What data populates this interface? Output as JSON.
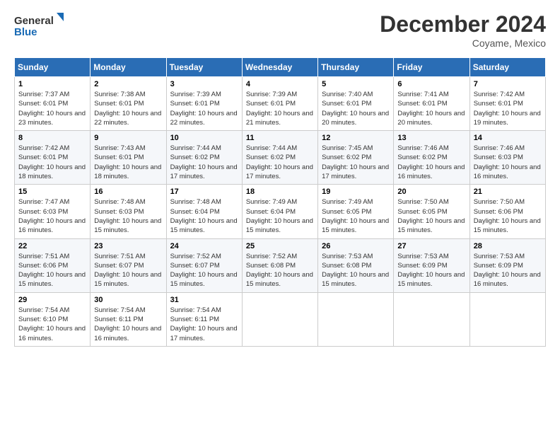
{
  "logo": {
    "line1": "General",
    "line2": "Blue"
  },
  "title": "December 2024",
  "location": "Coyame, Mexico",
  "weekdays": [
    "Sunday",
    "Monday",
    "Tuesday",
    "Wednesday",
    "Thursday",
    "Friday",
    "Saturday"
  ],
  "weeks": [
    [
      {
        "day": "1",
        "sunrise": "7:37 AM",
        "sunset": "6:01 PM",
        "daylight": "10 hours and 23 minutes."
      },
      {
        "day": "2",
        "sunrise": "7:38 AM",
        "sunset": "6:01 PM",
        "daylight": "10 hours and 22 minutes."
      },
      {
        "day": "3",
        "sunrise": "7:39 AM",
        "sunset": "6:01 PM",
        "daylight": "10 hours and 22 minutes."
      },
      {
        "day": "4",
        "sunrise": "7:39 AM",
        "sunset": "6:01 PM",
        "daylight": "10 hours and 21 minutes."
      },
      {
        "day": "5",
        "sunrise": "7:40 AM",
        "sunset": "6:01 PM",
        "daylight": "10 hours and 20 minutes."
      },
      {
        "day": "6",
        "sunrise": "7:41 AM",
        "sunset": "6:01 PM",
        "daylight": "10 hours and 20 minutes."
      },
      {
        "day": "7",
        "sunrise": "7:42 AM",
        "sunset": "6:01 PM",
        "daylight": "10 hours and 19 minutes."
      }
    ],
    [
      {
        "day": "8",
        "sunrise": "7:42 AM",
        "sunset": "6:01 PM",
        "daylight": "10 hours and 18 minutes."
      },
      {
        "day": "9",
        "sunrise": "7:43 AM",
        "sunset": "6:01 PM",
        "daylight": "10 hours and 18 minutes."
      },
      {
        "day": "10",
        "sunrise": "7:44 AM",
        "sunset": "6:02 PM",
        "daylight": "10 hours and 17 minutes."
      },
      {
        "day": "11",
        "sunrise": "7:44 AM",
        "sunset": "6:02 PM",
        "daylight": "10 hours and 17 minutes."
      },
      {
        "day": "12",
        "sunrise": "7:45 AM",
        "sunset": "6:02 PM",
        "daylight": "10 hours and 17 minutes."
      },
      {
        "day": "13",
        "sunrise": "7:46 AM",
        "sunset": "6:02 PM",
        "daylight": "10 hours and 16 minutes."
      },
      {
        "day": "14",
        "sunrise": "7:46 AM",
        "sunset": "6:03 PM",
        "daylight": "10 hours and 16 minutes."
      }
    ],
    [
      {
        "day": "15",
        "sunrise": "7:47 AM",
        "sunset": "6:03 PM",
        "daylight": "10 hours and 16 minutes."
      },
      {
        "day": "16",
        "sunrise": "7:48 AM",
        "sunset": "6:03 PM",
        "daylight": "10 hours and 15 minutes."
      },
      {
        "day": "17",
        "sunrise": "7:48 AM",
        "sunset": "6:04 PM",
        "daylight": "10 hours and 15 minutes."
      },
      {
        "day": "18",
        "sunrise": "7:49 AM",
        "sunset": "6:04 PM",
        "daylight": "10 hours and 15 minutes."
      },
      {
        "day": "19",
        "sunrise": "7:49 AM",
        "sunset": "6:05 PM",
        "daylight": "10 hours and 15 minutes."
      },
      {
        "day": "20",
        "sunrise": "7:50 AM",
        "sunset": "6:05 PM",
        "daylight": "10 hours and 15 minutes."
      },
      {
        "day": "21",
        "sunrise": "7:50 AM",
        "sunset": "6:06 PM",
        "daylight": "10 hours and 15 minutes."
      }
    ],
    [
      {
        "day": "22",
        "sunrise": "7:51 AM",
        "sunset": "6:06 PM",
        "daylight": "10 hours and 15 minutes."
      },
      {
        "day": "23",
        "sunrise": "7:51 AM",
        "sunset": "6:07 PM",
        "daylight": "10 hours and 15 minutes."
      },
      {
        "day": "24",
        "sunrise": "7:52 AM",
        "sunset": "6:07 PM",
        "daylight": "10 hours and 15 minutes."
      },
      {
        "day": "25",
        "sunrise": "7:52 AM",
        "sunset": "6:08 PM",
        "daylight": "10 hours and 15 minutes."
      },
      {
        "day": "26",
        "sunrise": "7:53 AM",
        "sunset": "6:08 PM",
        "daylight": "10 hours and 15 minutes."
      },
      {
        "day": "27",
        "sunrise": "7:53 AM",
        "sunset": "6:09 PM",
        "daylight": "10 hours and 15 minutes."
      },
      {
        "day": "28",
        "sunrise": "7:53 AM",
        "sunset": "6:09 PM",
        "daylight": "10 hours and 16 minutes."
      }
    ],
    [
      {
        "day": "29",
        "sunrise": "7:54 AM",
        "sunset": "6:10 PM",
        "daylight": "10 hours and 16 minutes."
      },
      {
        "day": "30",
        "sunrise": "7:54 AM",
        "sunset": "6:11 PM",
        "daylight": "10 hours and 16 minutes."
      },
      {
        "day": "31",
        "sunrise": "7:54 AM",
        "sunset": "6:11 PM",
        "daylight": "10 hours and 17 minutes."
      },
      null,
      null,
      null,
      null
    ]
  ]
}
